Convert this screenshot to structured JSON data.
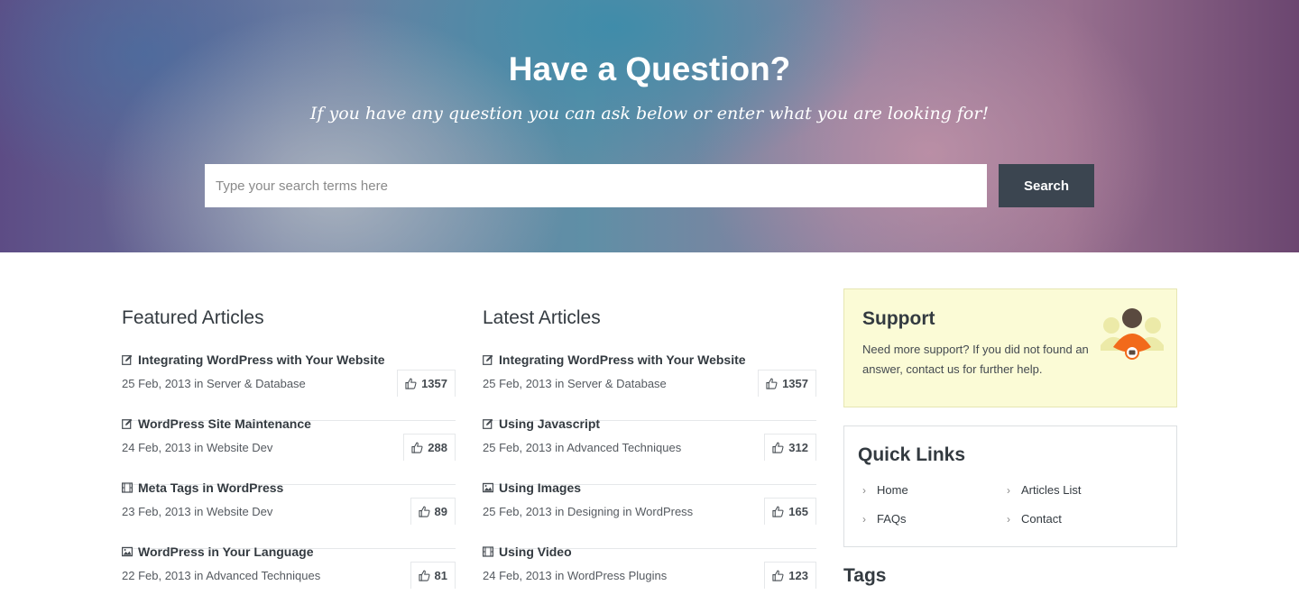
{
  "hero": {
    "title": "Have a Question?",
    "subtitle": "If you have any question you can ask below or enter what you are looking for!",
    "search_placeholder": "Type your search terms here",
    "search_button_label": "Search"
  },
  "featured": {
    "title": "Featured Articles",
    "articles": [
      {
        "icon": "edit-icon",
        "title": "Integrating WordPress with Your Website",
        "meta": "25 Feb, 2013 in Server & Database",
        "likes": "1357"
      },
      {
        "icon": "edit-icon",
        "title": "WordPress Site Maintenance",
        "meta": "24 Feb, 2013 in Website Dev",
        "likes": "288"
      },
      {
        "icon": "film-icon",
        "title": "Meta Tags in WordPress",
        "meta": "23 Feb, 2013 in Website Dev",
        "likes": "89"
      },
      {
        "icon": "image-icon",
        "title": "WordPress in Your Language",
        "meta": "22 Feb, 2013 in Advanced Techniques",
        "likes": "81"
      }
    ]
  },
  "latest": {
    "title": "Latest Articles",
    "articles": [
      {
        "icon": "edit-icon",
        "title": "Integrating WordPress with Your Website",
        "meta": "25 Feb, 2013 in Server & Database",
        "likes": "1357"
      },
      {
        "icon": "edit-icon",
        "title": "Using Javascript",
        "meta": "25 Feb, 2013 in Advanced Techniques",
        "likes": "312"
      },
      {
        "icon": "image-icon",
        "title": "Using Images",
        "meta": "25 Feb, 2013 in Designing in WordPress",
        "likes": "165"
      },
      {
        "icon": "film-icon",
        "title": "Using Video",
        "meta": "24 Feb, 2013 in WordPress Plugins",
        "likes": "123"
      }
    ]
  },
  "support": {
    "title": "Support",
    "text": "Need more support? If you did not found an answer, contact us for further help."
  },
  "quick_links": {
    "title": "Quick Links",
    "links": [
      "Home",
      "Articles List",
      "FAQs",
      "Contact"
    ]
  },
  "tags": {
    "title": "Tags"
  },
  "colors": {
    "search_button": "#3b4550",
    "support_bg": "#fbfbd6",
    "text": "#333a40"
  }
}
